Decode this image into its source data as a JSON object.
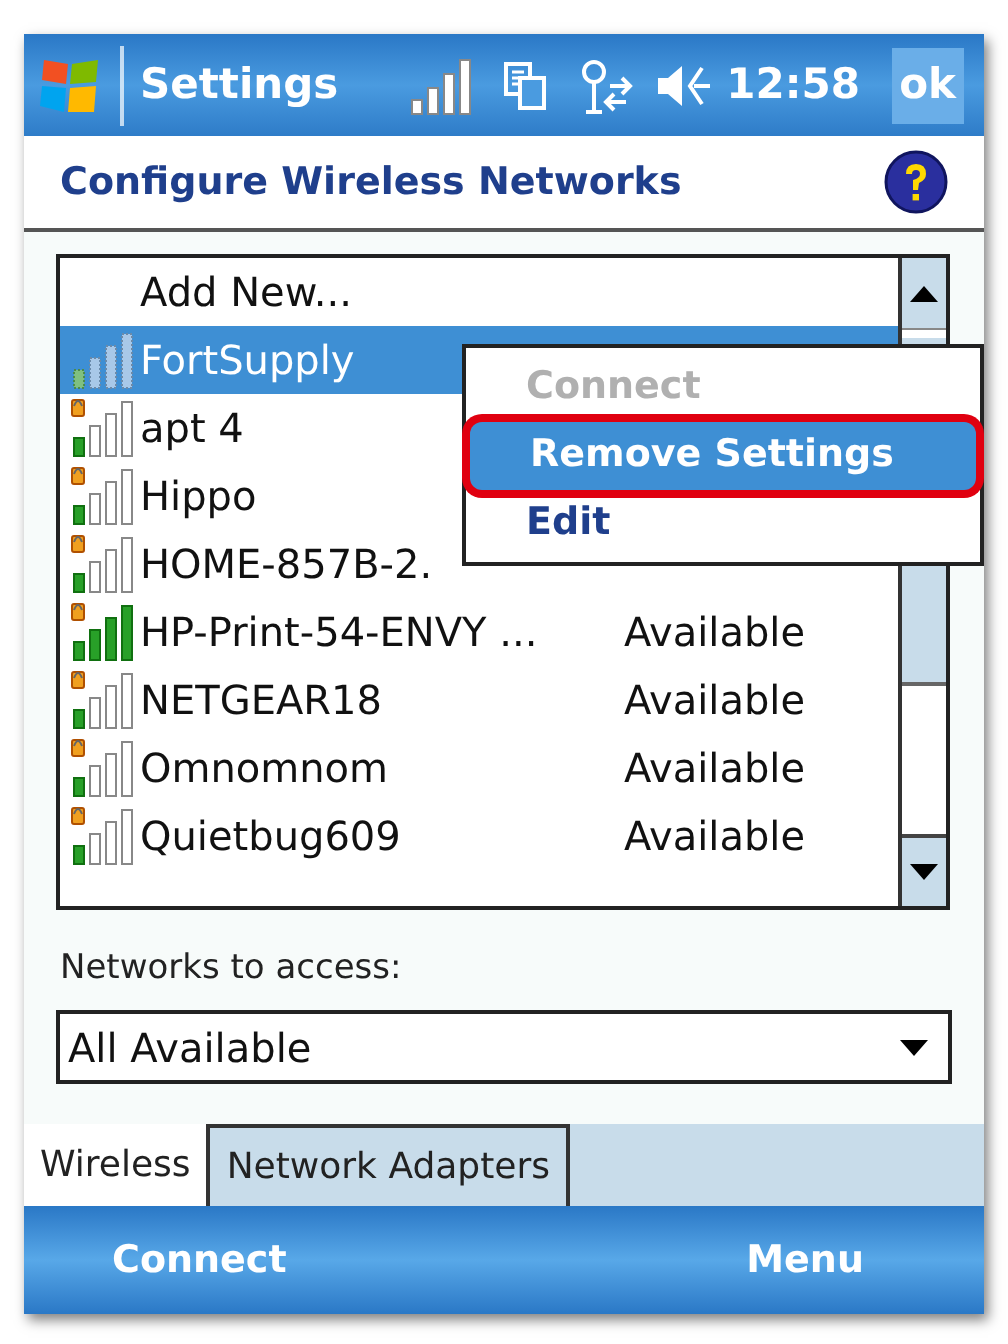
{
  "status_bar": {
    "title": "Settings",
    "time": "12:58",
    "ok": "ok"
  },
  "header": {
    "title": "Configure Wireless Networks"
  },
  "networks": [
    {
      "kind": "action",
      "name": "Add New...",
      "selected": false
    },
    {
      "kind": "network",
      "name": "FortSupply",
      "full_signal": false,
      "selected": true
    },
    {
      "kind": "network",
      "name": "apt 4",
      "full_signal": false,
      "selected": false
    },
    {
      "kind": "network",
      "name": "Hippo",
      "full_signal": false,
      "selected": false
    },
    {
      "kind": "network",
      "name": "HOME-857B-2.",
      "full_signal": false,
      "selected": false
    },
    {
      "kind": "network",
      "name": "HP-Print-54-ENVY ...",
      "status": "Available",
      "full_signal": true,
      "selected": false
    },
    {
      "kind": "network",
      "name": "NETGEAR18",
      "status": "Available",
      "full_signal": false,
      "selected": false
    },
    {
      "kind": "network",
      "name": "Omnomnom",
      "status": "Available",
      "full_signal": false,
      "selected": false
    },
    {
      "kind": "network",
      "name": "Quietbug609",
      "status": "Available",
      "full_signal": false,
      "selected": false
    }
  ],
  "context_menu": [
    {
      "label": "Connect",
      "disabled": true,
      "selected": false
    },
    {
      "label": "Remove Settings",
      "disabled": false,
      "selected": true
    },
    {
      "label": "Edit",
      "disabled": false,
      "selected": false
    }
  ],
  "filter": {
    "label": "Networks to access:",
    "value": "All Available"
  },
  "tabs": [
    {
      "label": "Wireless",
      "selected": true
    },
    {
      "label": "Network Adapters",
      "selected": false
    }
  ],
  "softkeys": [
    "Connect",
    "Menu"
  ]
}
